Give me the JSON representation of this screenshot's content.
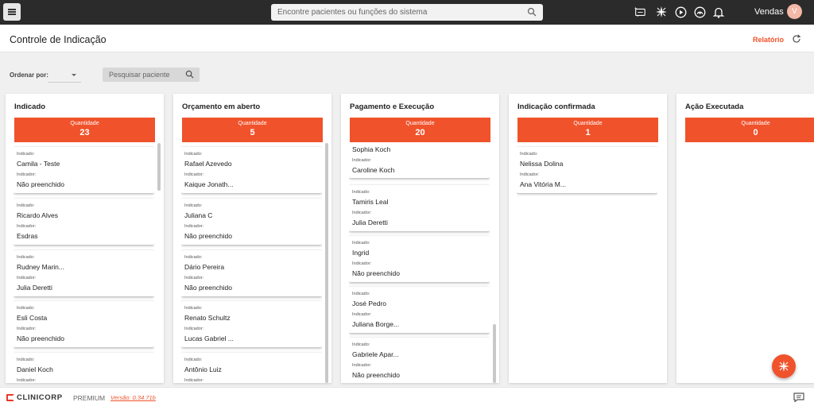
{
  "topbar": {
    "search_placeholder": "Encontre pacientes ou funções do sistema",
    "user_name": "Vendas",
    "avatar_initial": "V",
    "icons": [
      "ai-chat-icon",
      "sparkle-icon",
      "play-icon",
      "support-icon",
      "bell-icon"
    ]
  },
  "header": {
    "title": "Controle de Indicação",
    "report_label": "Relatório"
  },
  "filters": {
    "order_label": "Ordenar por:",
    "order_value": "",
    "patient_search_placeholder": "Pesquisar paciente"
  },
  "qty_label": "Quantidade",
  "field_labels": {
    "indicado": "Indicado:",
    "indicador": "Indicador:"
  },
  "columns": [
    {
      "title": "Indicado",
      "quantity": "23",
      "cards": [
        {
          "indicado": "Camila - Teste",
          "indicador": "Não preenchido"
        },
        {
          "indicado": "Ricardo Alves",
          "indicador": "Esdras"
        },
        {
          "indicado": "Rudney Marin...",
          "indicador": "Julia Deretti"
        },
        {
          "indicado": "Esli Costa",
          "indicador": "Não preenchido"
        },
        {
          "indicado": "Daniel Koch",
          "indicador": ""
        }
      ]
    },
    {
      "title": "Orçamento em aberto",
      "quantity": "5",
      "cards": [
        {
          "indicado": "Rafael Azevedo",
          "indicador": "Kaique Jonath..."
        },
        {
          "indicado": "Juliana C",
          "indicador": "Não preenchido"
        },
        {
          "indicado": "Dário Pereira",
          "indicador": "Não preenchido"
        },
        {
          "indicado": "Renato Schultz",
          "indicador": "Lucas Gabriel ..."
        },
        {
          "indicado": "Antônio Luiz",
          "indicador": ""
        }
      ]
    },
    {
      "title": "Pagamento e Execução",
      "quantity": "20",
      "cards": [
        {
          "indicado": "Sophia Koch",
          "indicador": "Caroline Koch"
        },
        {
          "indicado": "Tamiris Leal",
          "indicador": "Julia Deretti"
        },
        {
          "indicado": "Ingrid",
          "indicador": "Não preenchido"
        },
        {
          "indicado": "José Pedro",
          "indicador": "Juliana Borge..."
        },
        {
          "indicado": "Gabriele Apar...",
          "indicador": "Não preenchido"
        }
      ]
    },
    {
      "title": "Indicação confirmada",
      "quantity": "1",
      "cards": [
        {
          "indicado": "Nelissa Dolina",
          "indicador": "Ana Vitória M..."
        }
      ]
    },
    {
      "title": "Ação Executada",
      "quantity": "0",
      "cards": []
    }
  ],
  "footer": {
    "logo": "CLINICORP",
    "edition": "PREMIUM",
    "version": "Versão: 0.34.71b"
  },
  "colors": {
    "accent": "#f0522b",
    "topbar": "#2b2b2b"
  }
}
